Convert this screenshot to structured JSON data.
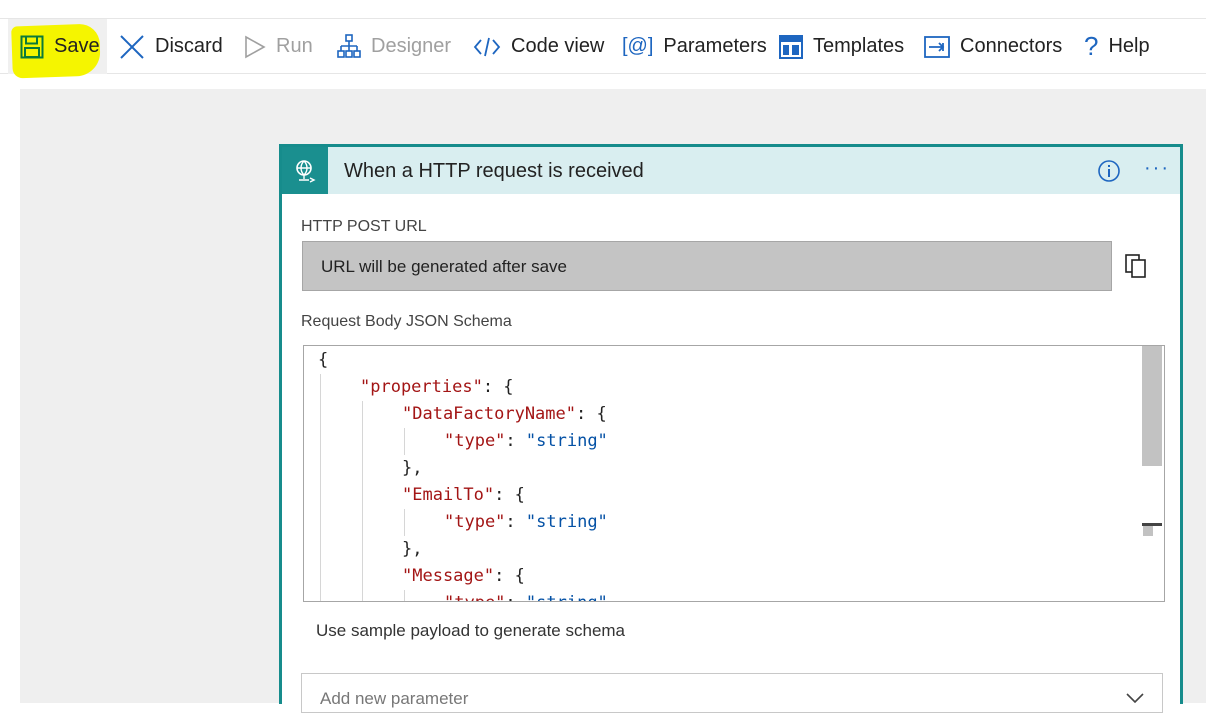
{
  "toolbar": {
    "save": "Save",
    "discard": "Discard",
    "run": "Run",
    "designer": "Designer",
    "code_view": "Code view",
    "parameters": "Parameters",
    "templates": "Templates",
    "connectors": "Connectors",
    "help": "Help"
  },
  "trigger": {
    "title": "When a HTTP request is received",
    "url_label": "HTTP POST URL",
    "url_value": "URL will be generated after save",
    "schema_label": "Request Body JSON Schema",
    "schema_lines": [
      {
        "indent": 0,
        "parts": [
          [
            "p",
            "{"
          ]
        ]
      },
      {
        "indent": 1,
        "parts": [
          [
            "k",
            "\"properties\""
          ],
          [
            "p",
            ": {"
          ]
        ]
      },
      {
        "indent": 2,
        "parts": [
          [
            "k",
            "\"DataFactoryName\""
          ],
          [
            "p",
            ": {"
          ]
        ]
      },
      {
        "indent": 3,
        "parts": [
          [
            "k",
            "\"type\""
          ],
          [
            "p",
            ": "
          ],
          [
            "s",
            "\"string\""
          ]
        ]
      },
      {
        "indent": 2,
        "parts": [
          [
            "p",
            "},"
          ]
        ]
      },
      {
        "indent": 2,
        "parts": [
          [
            "k",
            "\"EmailTo\""
          ],
          [
            "p",
            ": {"
          ]
        ]
      },
      {
        "indent": 3,
        "parts": [
          [
            "k",
            "\"type\""
          ],
          [
            "p",
            ": "
          ],
          [
            "s",
            "\"string\""
          ]
        ]
      },
      {
        "indent": 2,
        "parts": [
          [
            "p",
            "},"
          ]
        ]
      },
      {
        "indent": 2,
        "parts": [
          [
            "k",
            "\"Message\""
          ],
          [
            "p",
            ": {"
          ]
        ]
      },
      {
        "indent": 3,
        "parts": [
          [
            "k",
            "\"type\""
          ],
          [
            "p",
            ": "
          ],
          [
            "s",
            "\"string\""
          ]
        ]
      }
    ],
    "sample_payload_link": "Use sample payload to generate schema",
    "add_parameter_placeholder": "Add new parameter"
  },
  "colors": {
    "accent_teal": "#168c8c",
    "header_bg": "#d9eef0",
    "link_blue": "#1e66c0",
    "highlight_yellow": "#f5f500"
  },
  "icons": {
    "save": "save-floppy-icon",
    "discard": "close-x-icon",
    "run": "play-triangle-icon",
    "designer": "designer-hierarchy-icon",
    "code_view": "code-brackets-icon",
    "parameters": "parameters-at-icon",
    "templates": "templates-grid-icon",
    "connectors": "connectors-plug-icon",
    "help": "help-question-icon",
    "trigger": "http-globe-icon",
    "info": "info-circle-icon",
    "more": "ellipsis-icon",
    "copy": "copy-icon",
    "chevron": "chevron-down-icon"
  }
}
